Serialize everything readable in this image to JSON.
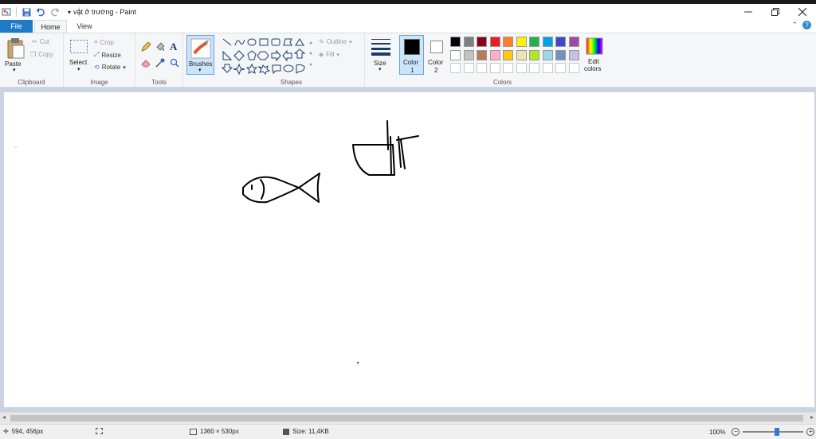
{
  "titlebar": {
    "title": "vật ở trường - Paint"
  },
  "tabs": {
    "file": "File",
    "home": "Home",
    "view": "View"
  },
  "clipboard": {
    "paste": "Paste",
    "cut": "Cut",
    "copy": "Copy",
    "label": "Clipboard"
  },
  "image": {
    "select": "Select",
    "crop": "Crop",
    "resize": "Resize",
    "rotate": "Rotate",
    "label": "Image"
  },
  "tools": {
    "label": "Tools"
  },
  "brushes": {
    "label": "Brushes"
  },
  "shapes": {
    "outline": "Outline",
    "fill": "Fill",
    "label": "Shapes"
  },
  "size": {
    "label": "Size"
  },
  "color1": {
    "label": "Color",
    "num": "1",
    "value": "#000000"
  },
  "color2": {
    "label": "Color",
    "num": "2",
    "value": "#ffffff"
  },
  "colors": {
    "label": "Colors",
    "edit_line1": "Edit",
    "edit_line2": "colors",
    "row1": [
      "#000000",
      "#7f7f7f",
      "#880015",
      "#ed1c24",
      "#ff7f27",
      "#fff200",
      "#22b14c",
      "#00a2e8",
      "#3f48cc",
      "#a349a4"
    ],
    "row2": [
      "#ffffff",
      "#c3c3c3",
      "#b97a57",
      "#ffaec9",
      "#ffc90e",
      "#efe4b0",
      "#b5e61d",
      "#99d9ea",
      "#7092be",
      "#c8bfe7"
    ],
    "row3": [
      "#ffffff",
      "#ffffff",
      "#ffffff",
      "#ffffff",
      "#ffffff",
      "#ffffff",
      "#ffffff",
      "#ffffff",
      "#ffffff",
      "#ffffff"
    ]
  },
  "status": {
    "cursor": "594, 456px",
    "dimensions": "1360 × 530px",
    "size": "Size: 11,4KB",
    "zoom": "100%"
  }
}
